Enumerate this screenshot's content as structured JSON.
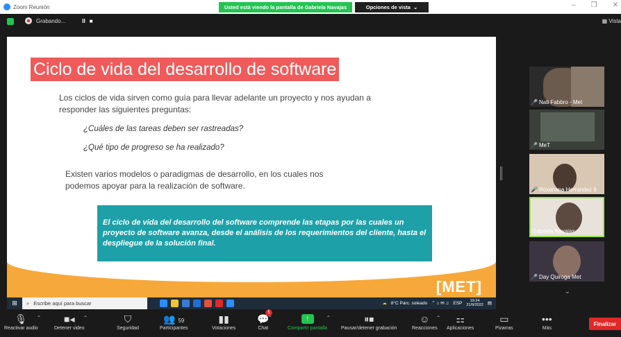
{
  "window": {
    "title": "Zoom Reunión",
    "share_banner": "Usted está viendo la pantalla de Gabriela Navajas",
    "view_options": "Opciones de vista",
    "vista_label": "Vista"
  },
  "recording": {
    "label": "Grabando...",
    "pause_label": "II",
    "stop_label": "■"
  },
  "slide": {
    "title": "Ciclo de vida del desarrollo de software",
    "intro": "Los ciclos de vida sirven como guía para llevar adelante un proyecto y nos  ayudan a responder las siguientes preguntas:",
    "question_1": "¿Cuáles de las tareas deben ser rastreadas?",
    "question_2": "¿Qué tipo de progreso se ha realizado?",
    "paragraph_2": "Existen varios modelos o paradigmas de desarrollo, en los cuales  nos podemos apoyar para la realización de software.",
    "callout": "El ciclo de vida del desarrollo del software comprende las etapas por las cuales un proyecto de software avanza, desde el análisis de los requerimientos del cliente, hasta el despliegue de la solución final.",
    "logo": "[MET]",
    "colors": {
      "title_bg": "#ef5b5b",
      "callout_bg": "#1ea0a8",
      "footer": "#f7a83a"
    }
  },
  "shared_taskbar": {
    "search_placeholder": "Escribe aquí para buscar",
    "weather": "8°C  Parc. soleado",
    "lang": "ESP",
    "time": "19:24",
    "date": "21/9/2022"
  },
  "participants": [
    {
      "name": "Nati Fabbro - Met",
      "muted": true
    },
    {
      "name": "MeT",
      "muted": true
    },
    {
      "name": "Roxanana Herrandez 9",
      "muted": true
    },
    {
      "name": "Gabriela Navajas",
      "muted": false,
      "active": true
    },
    {
      "name": "Day Quiroga Met",
      "muted": true
    }
  ],
  "toolbar": {
    "mute": "Reactivar audio",
    "video": "Detener video",
    "security": "Seguridad",
    "participants": "Participantes",
    "participants_count": "59",
    "polls": "Votaciones",
    "chat": "Chat",
    "chat_badge": "5",
    "share": "Compartir pantalla",
    "record": "Pausar/detener grabación",
    "reactions": "Reacciones",
    "apps": "Aplicaciones",
    "whiteboards": "Pizarras",
    "more": "Más",
    "end": "Finalizar"
  }
}
